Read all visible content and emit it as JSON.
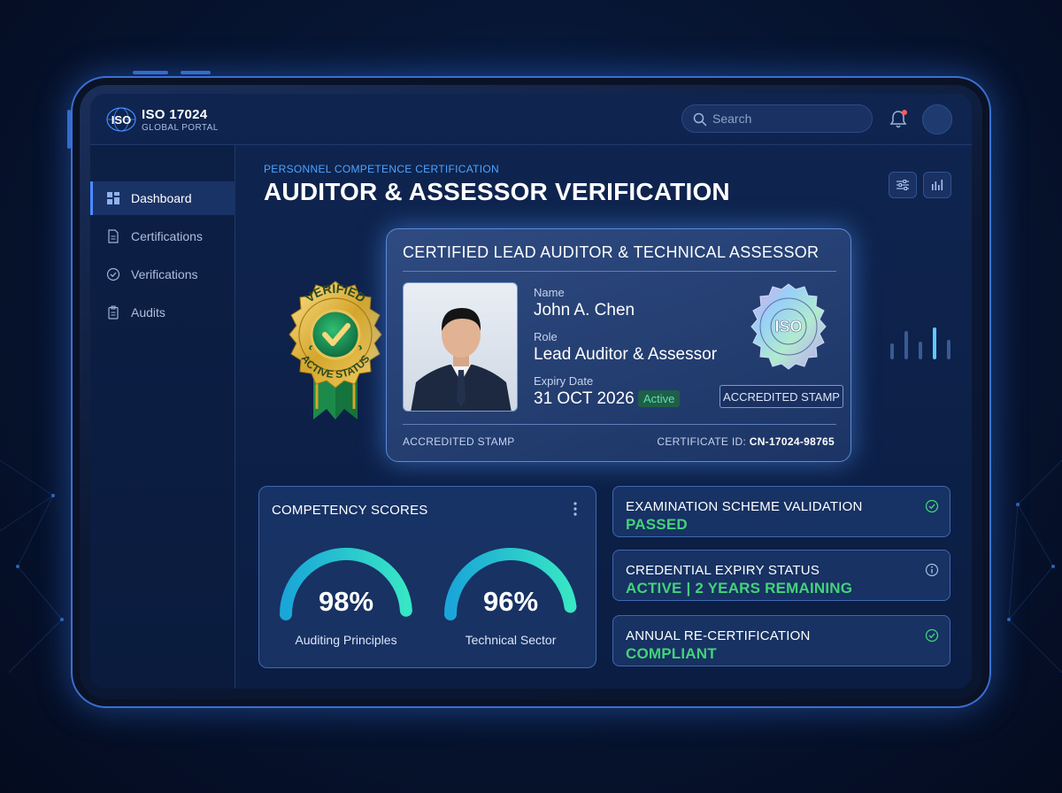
{
  "brand": {
    "title": "ISO 17024",
    "subtitle": "GLOBAL PORTAL",
    "logo_text": "ISO"
  },
  "search": {
    "placeholder": "Search"
  },
  "sidebar": {
    "items": [
      {
        "label": "Dashboard",
        "icon": "grid-icon",
        "active": true
      },
      {
        "label": "Certifications",
        "icon": "document-icon",
        "active": false
      },
      {
        "label": "Verifications",
        "icon": "check-circle-icon",
        "active": false
      },
      {
        "label": "Audits",
        "icon": "clipboard-icon",
        "active": false
      }
    ]
  },
  "header": {
    "kicker": "PERSONNEL COMPETENCE CERTIFICATION",
    "title": "AUDITOR & ASSESSOR VERIFICATION"
  },
  "badge": {
    "top_text": "VERIFIED",
    "bottom_text": "ACTIVE STATUS"
  },
  "certificate": {
    "title": "CERTIFIED LEAD AUDITOR & TECHNICAL ASSESSOR",
    "name_label": "Name",
    "name": "John A. Chen",
    "role_label": "Role",
    "role": "Lead Auditor & Assessor",
    "expiry_label": "Expiry Date",
    "expiry": "31 OCT 2026",
    "status": "Active",
    "stamp_button": "ACCREDITED STAMP",
    "footer_left": "ACCREDITED STAMP",
    "certificate_id_label": "CERTIFICATE ID:",
    "certificate_id": "CN-17024-98765",
    "seal_text": "ISO"
  },
  "competency": {
    "title": "COMPETENCY SCORES",
    "scores": [
      {
        "label": "Auditing Principles",
        "value_text": "98%",
        "value": 0.98
      },
      {
        "label": "Technical Sector",
        "value_text": "96%",
        "value": 0.96
      }
    ]
  },
  "status_cards": [
    {
      "label": "EXAMINATION SCHEME VALIDATION",
      "value": "PASSED",
      "icon": "check-circle-icon"
    },
    {
      "label": "CREDENTIAL EXPIRY STATUS",
      "value": "ACTIVE | 2 YEARS REMAINING",
      "icon": "info-icon"
    },
    {
      "label": "ANNUAL RE-CERTIFICATION",
      "value": "COMPLIANT",
      "icon": "check-circle-icon"
    }
  ],
  "colors": {
    "accent": "#4a8cff",
    "success": "#44d27a",
    "gauge_start": "#1aa6d8",
    "gauge_end": "#37e6c4"
  }
}
